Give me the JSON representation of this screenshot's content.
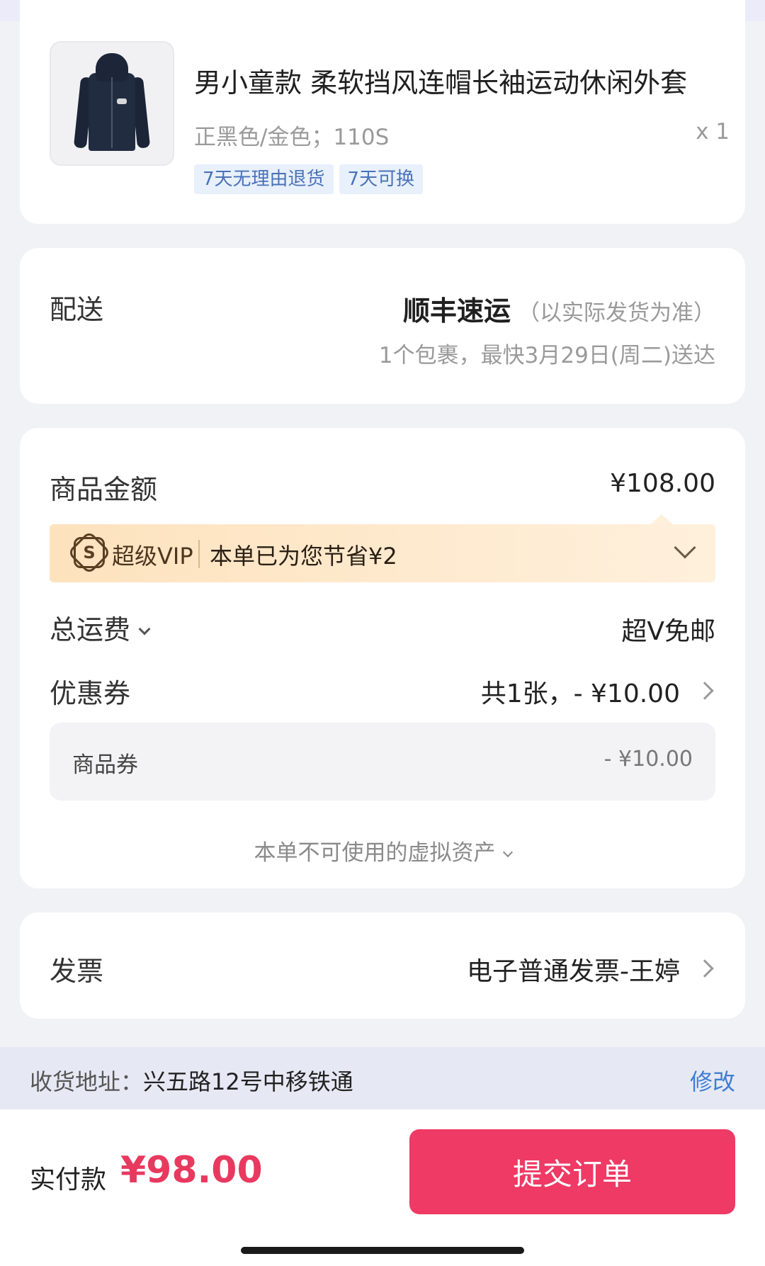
{
  "product": {
    "title": "男小童款 柔软挡风连帽长袖运动休闲外套",
    "spec": "正黑色/金色；110S",
    "qty": "x 1",
    "tags": [
      "7天无理由退货",
      "7天可换"
    ]
  },
  "delivery": {
    "label": "配送",
    "carrier": "顺丰速运",
    "carrier_note": "（以实际发货为准）",
    "eta": "1个包裹，最快3月29日(周二)送达"
  },
  "amount": {
    "goods_label": "商品金额",
    "goods_value": "¥108.00",
    "vip_brand": "超级VIP",
    "vip_saving": "本单已为您节省¥2",
    "shipping_label": "总运费",
    "shipping_value": "超V免邮",
    "coupon_label": "优惠券",
    "coupon_value": "共1张，- ¥10.00",
    "coupon_item_label": "商品券",
    "coupon_item_value": "- ¥10.00",
    "virtual_assets": "本单不可使用的虚拟资产"
  },
  "invoice": {
    "label": "发票",
    "value": "电子普通发票-王婷"
  },
  "address": {
    "label": "收货地址：",
    "value": "兴五路12号中移铁通",
    "edit": "修改"
  },
  "footer": {
    "pay_label": "实付款",
    "pay_amount": "¥98.00",
    "submit": "提交订单"
  },
  "colors": {
    "accent": "#ee3a64",
    "price": "#e8395f",
    "link": "#3f7ed3",
    "vip_bg": "#fde2bd"
  }
}
